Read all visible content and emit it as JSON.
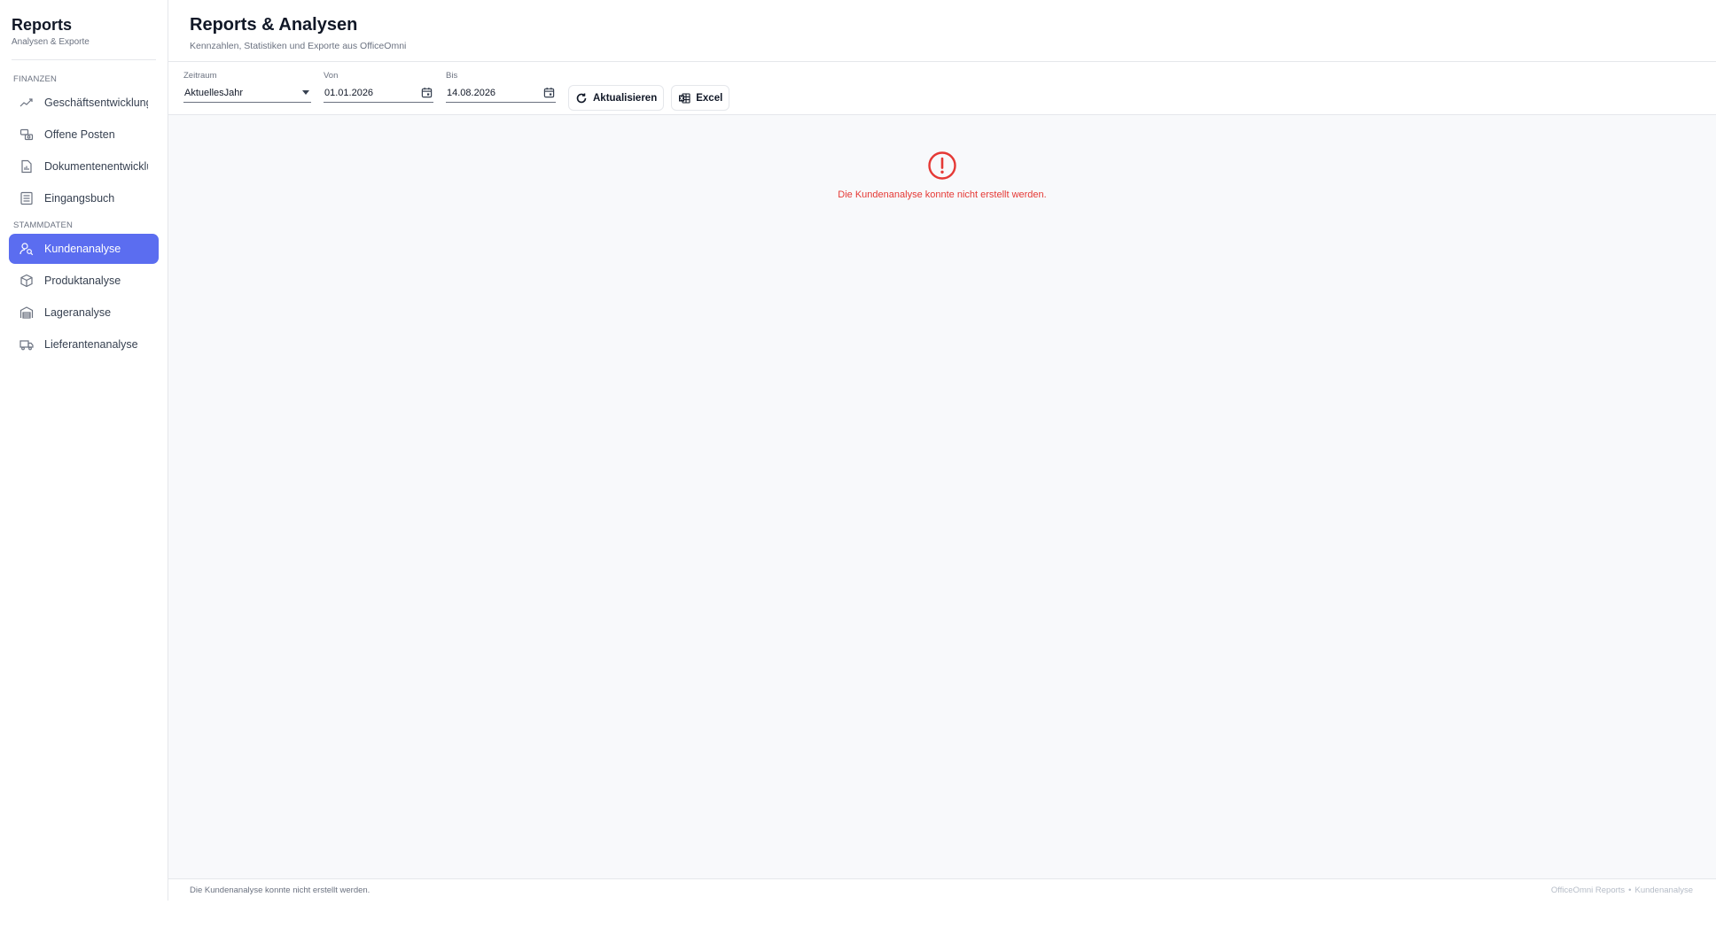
{
  "sidebar": {
    "title": "Reports",
    "subtitle": "Analysen & Exporte",
    "sections": [
      {
        "label": "FINANZEN",
        "items": [
          {
            "label": "Geschäftsentwicklung",
            "icon": "trend-line-icon"
          },
          {
            "label": "Offene Posten",
            "icon": "money-exchange-icon"
          },
          {
            "label": "Dokumentenentwicklu",
            "icon": "document-chart-icon"
          },
          {
            "label": "Eingangsbuch",
            "icon": "ledger-list-icon"
          }
        ]
      },
      {
        "label": "STAMMDATEN",
        "items": [
          {
            "label": "Kundenanalyse",
            "icon": "user-search-icon",
            "active": true
          },
          {
            "label": "Produktanalyse",
            "icon": "box-icon"
          },
          {
            "label": "Lageranalyse",
            "icon": "warehouse-icon"
          },
          {
            "label": "Lieferantenanalyse",
            "icon": "truck-icon"
          }
        ]
      }
    ]
  },
  "header": {
    "title": "Reports & Analysen",
    "subtitle": "Kennzahlen, Statistiken und Exporte aus OfficeOmni"
  },
  "toolbar": {
    "zeitraum_label": "Zeitraum",
    "zeitraum_value": "AktuellesJahr",
    "von_label": "Von",
    "von_value": "01.01.2026",
    "bis_label": "Bis",
    "bis_value": "14.08.2026",
    "refresh_label": "Aktualisieren",
    "excel_label": "Excel"
  },
  "content": {
    "error_message": "Die Kundenanalyse konnte nicht erstellt werden."
  },
  "footer": {
    "status": "Die Kundenanalyse konnte nicht erstellt werden.",
    "app": "OfficeOmni Reports",
    "separator": "•",
    "view": "Kundenanalyse"
  },
  "colors": {
    "accent": "#5b6df0",
    "error": "#e53935"
  }
}
